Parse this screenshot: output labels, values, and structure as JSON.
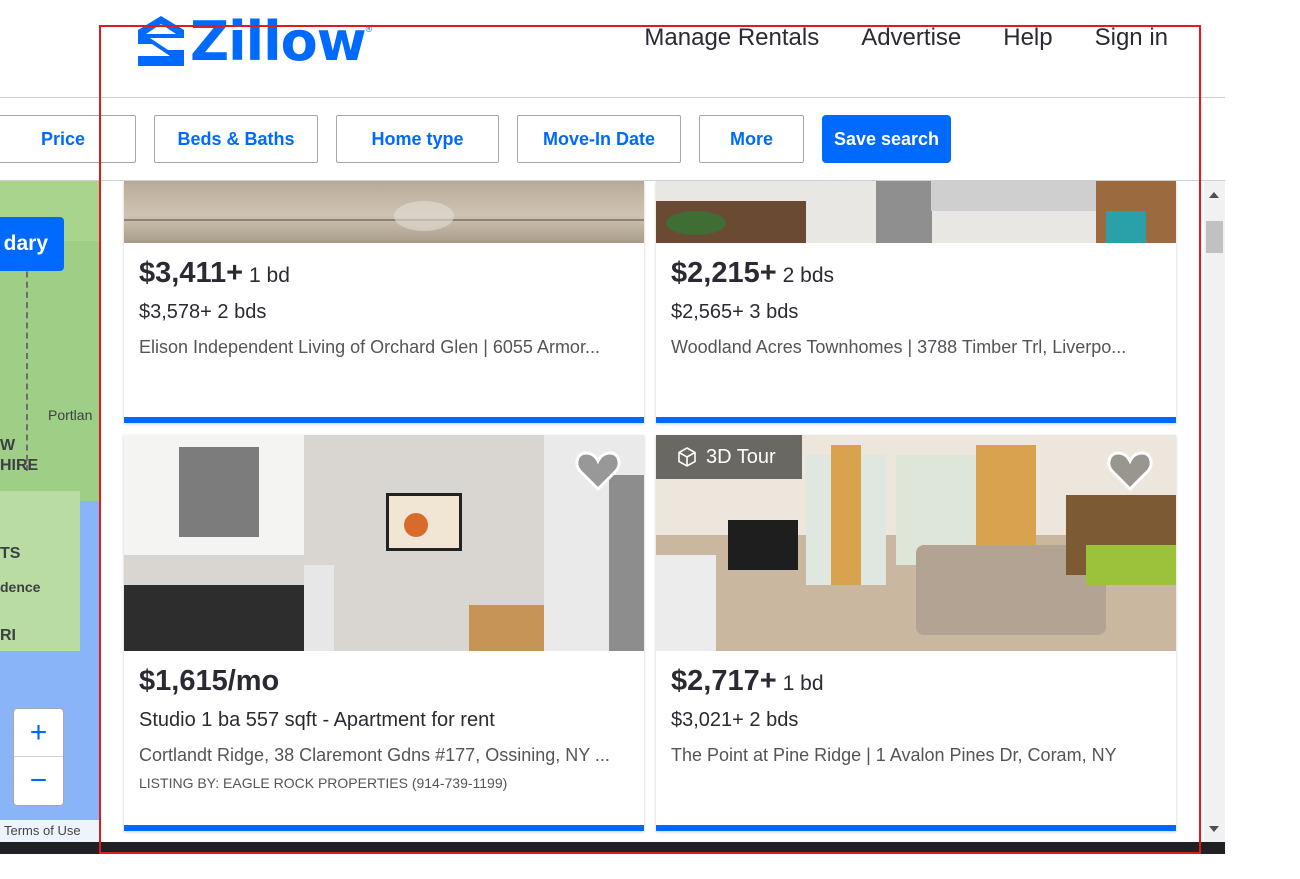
{
  "header": {
    "logo_text": "Zillow",
    "logo_reg": "®",
    "nav": [
      "Manage Rentals",
      "Advertise",
      "Help",
      "Sign in"
    ]
  },
  "filters": {
    "price": "Price",
    "beds_baths": "Beds & Baths",
    "home_type": "Home type",
    "move_in": "Move-In Date",
    "more": "More",
    "save": "Save search"
  },
  "map": {
    "boundary_button": "dary",
    "labels": [
      "Portlan",
      "W",
      "HIRE",
      "TS",
      "dence",
      "RI"
    ],
    "zoom_in": "+",
    "zoom_out": "−",
    "terms": "Terms of Use"
  },
  "listings": [
    {
      "price": "$3,411+",
      "beds": "1 bd",
      "sub": "$3,578+ 2 bds",
      "address": "Elison Independent Living of Orchard Glen | 6055 Armor..."
    },
    {
      "price": "$2,215+",
      "beds": "2 bds",
      "sub": "$2,565+ 3 bds",
      "address": "Woodland Acres Townhomes | 3788 Timber Trl, Liverpo..."
    },
    {
      "price": "$1,615/mo",
      "beds": "",
      "sub": "Studio  1 ba  557 sqft  - Apartment for rent",
      "address": "Cortlandt Ridge, 38 Claremont Gdns #177, Ossining, NY ...",
      "listing_by": "LISTING BY: EAGLE ROCK PROPERTIES (914-739-1199)"
    },
    {
      "price": "$2,717+",
      "beds": "1 bd",
      "sub": "$3,021+ 2 bds",
      "address": "The Point at Pine Ridge | 1 Avalon Pines Dr, Coram, NY",
      "badge": "3D Tour"
    }
  ],
  "colors": {
    "brand": "#006aff",
    "text": "#2a2a33",
    "highlight_outline": "#e01b1b"
  }
}
